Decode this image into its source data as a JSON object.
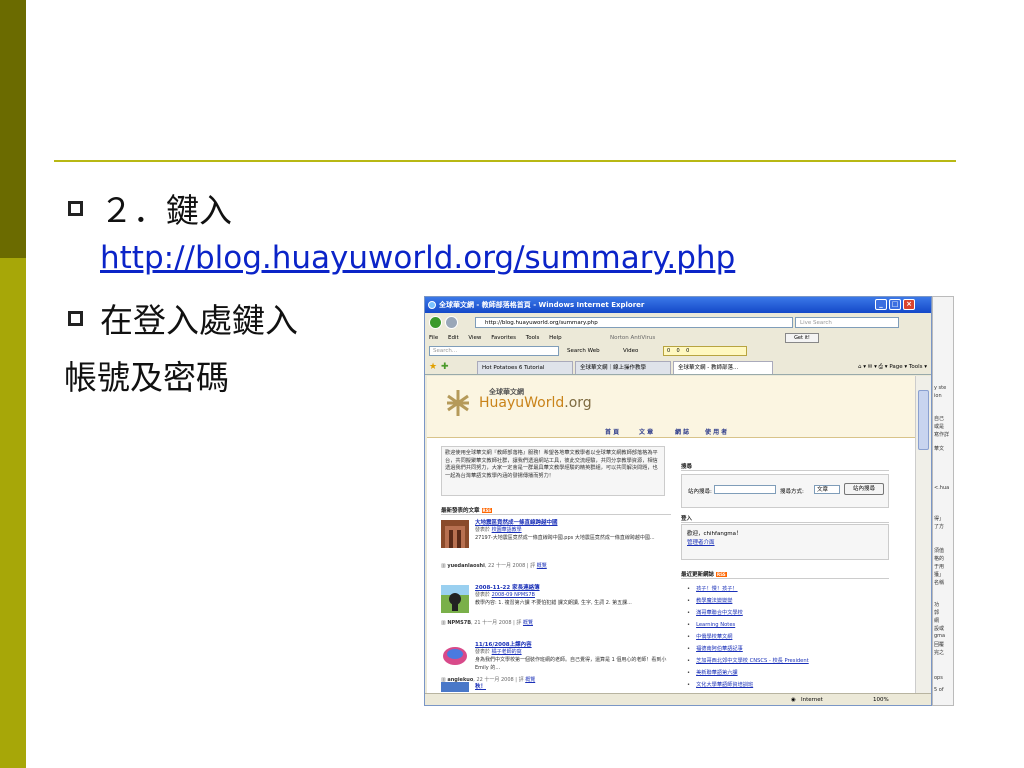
{
  "slide": {
    "bullet1_text": "２．鍵入",
    "bullet1_link": "http://blog.huayuworld.org/summary.php",
    "bullet2_text": "在登入處鍵入",
    "bullet2_cont": "帳號及密碼"
  },
  "browser": {
    "window_title": "全球華文網 - 教師部落格首頁 - Windows Internet Explorer",
    "address": "http://blog.huayuworld.org/summary.php",
    "search_placeholder": "Live Search",
    "menu": [
      "File",
      "Edit",
      "View",
      "Favorites",
      "Tools",
      "Help"
    ],
    "norton": "Norton AntiVirus",
    "getit": "Get it!",
    "toolbar_search": "Search...",
    "search_web": "Search Web",
    "video": "Video",
    "counters": [
      "0",
      "0",
      "0"
    ],
    "tabs": [
      "Hot Potatoes 6 Tutorial",
      "全球華文網｜線上操作教學",
      "全球華文網 - 教師部落..."
    ],
    "page_menu": "Page",
    "tools_menu": "Tools",
    "status_zone": "Internet",
    "zoom": "100%"
  },
  "site": {
    "logo_cn": "全球華文網",
    "logo_en_a": "Huayu",
    "logo_en_b": "World",
    "logo_en_c": ".org",
    "nav": [
      "首 頁",
      "文 章",
      "網 誌",
      "使 用 者"
    ],
    "welcome": "歡迎使用全球華文網『教師部落格』服務！希望各地華文教學者以全球華文網教師部落格為平台，共同擬聚華文教師社群，讓我們透過網站工具，彼此交流經驗，共同分享教學資源，相信透過我們共同努力，大家一定會是一群最具華文教學經驗的精英群組，可以共同解決問題，也一起為台灣華語文教學內涵的發揚傳播而努力！",
    "latest_title": "最新發表的文章",
    "search_title": "搜尋",
    "search_label": "站內搜尋:",
    "search_mode_label": "搜尋方式:",
    "search_mode": "文章",
    "search_button": "站內搜尋",
    "login_title": "登入",
    "login_welcome": "歡迎，chihfangma！",
    "login_admin": "管理者介面",
    "recent_blogs_title": "最近更新網誌",
    "recent_blogs": [
      "孩子！慢！孩子！",
      "教學魔法變變變",
      "滿哥華聯合中文學校",
      "Learning Notes",
      "中僑學校華文網",
      "福德南阿伯華語記事",
      "芝加哥西北郊中文學校 CNSCS - 校長 President",
      "美新聯華語第六課",
      "文化大學華語師資培訓班"
    ],
    "posts": [
      {
        "title": "大地震區竟然成一條直線跨越中國",
        "meta_prefix": "發表於",
        "category": "校園華語教學",
        "body": "27197-大地震區竟然成一條直線跨中國.pps  大地震區竟然成一條直線跨越中國...",
        "author": "yuedanlaoshi",
        "date": "22 十一月 2008 | 評",
        "foot_link": "概覽"
      },
      {
        "title": "2008-11-22 家長連絡簿",
        "meta_prefix": "發表於",
        "category": "2008-09 NPMS7B",
        "body": "教學內容: 1. 複習第六課  不要怕犯錯  課文朗讀, 生字, 生詞  2. 第五課...",
        "author": "NPMS7B",
        "date": "21 十一月 2008 | 評",
        "foot_link": "概覽"
      },
      {
        "title": "11/16/2008上課內容",
        "meta_prefix": "發表於",
        "category": "橘子老師的窩",
        "body": "身為我們中文學校第一個裝作班網的老師。自己覺得，還算是 1 個用心的老師！看到小 Emily 的...",
        "author": "angiekuo",
        "date": "22 十一月 2008 | 評",
        "foot_link": "概覽"
      },
      {
        "title": "秋！",
        "meta_prefix": "",
        "category": "",
        "body": "",
        "author": "",
        "date": "",
        "foot_link": ""
      }
    ]
  },
  "strip_text": [
    "y ste",
    "ion",
    "自己",
    "或是",
    "寫作詳",
    "華文",
    "<.hua",
    "得」",
    "了方",
    "須值",
    "格的",
    "于用",
    "獲」",
    "名稱",
    "功",
    "郭",
    "網",
    "設或",
    "gma",
    "回覆",
    "完之",
    "ops",
    "5 of"
  ],
  "colors": {
    "bar_dark": "#6b6b00",
    "bar_light": "#a7a708",
    "divider": "#b8b814",
    "link": "#0b24c8"
  }
}
